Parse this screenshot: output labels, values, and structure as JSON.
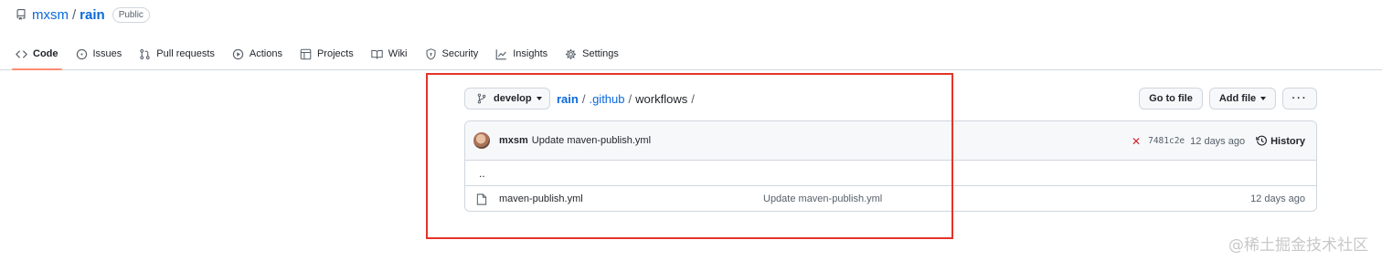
{
  "repo": {
    "owner": "mxsm",
    "separator": "/",
    "name": "rain",
    "visibility": "Public"
  },
  "nav": {
    "tabs": [
      {
        "label": "Code",
        "icon": "code-icon",
        "active": true
      },
      {
        "label": "Issues",
        "icon": "issue-icon"
      },
      {
        "label": "Pull requests",
        "icon": "pull-request-icon"
      },
      {
        "label": "Actions",
        "icon": "play-icon"
      },
      {
        "label": "Projects",
        "icon": "table-icon"
      },
      {
        "label": "Wiki",
        "icon": "book-icon"
      },
      {
        "label": "Security",
        "icon": "shield-icon"
      },
      {
        "label": "Insights",
        "icon": "graph-icon"
      },
      {
        "label": "Settings",
        "icon": "gear-icon"
      }
    ]
  },
  "branch": {
    "label": "develop"
  },
  "breadcrumb": {
    "root": "rain",
    "parts": [
      ".github"
    ],
    "current": "workflows",
    "sep": "/"
  },
  "actions": {
    "goto_label": "Go to file",
    "add_label": "Add file",
    "more_label": "···"
  },
  "commit": {
    "author": "mxsm",
    "message": "Update maven-publish.yml",
    "status": "failed",
    "status_color": "#cf222e",
    "sha": "7481c2e",
    "age": "12 days ago",
    "history_label": "History"
  },
  "files": {
    "parent": "..",
    "items": [
      {
        "name": "maven-publish.yml",
        "message": "Update maven-publish.yml",
        "age": "12 days ago"
      }
    ]
  },
  "watermark": "@稀土掘金技术社区",
  "colors": {
    "link": "#0969da",
    "annotation_border": "#e5332a",
    "active_tab_underline": "#fd8c73"
  }
}
